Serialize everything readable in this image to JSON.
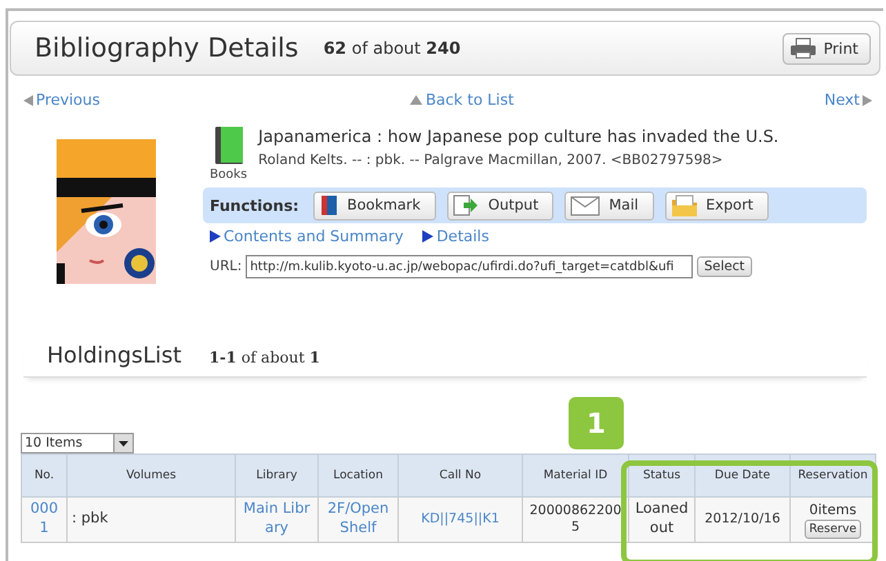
{
  "header": {
    "title": "Bibliography Details",
    "count": "**62** of about **240**",
    "print_button": "Print"
  },
  "nav": {
    "previous": "Previous",
    "back": "Back to List",
    "next": "Next"
  },
  "record": {
    "material_type": "Books",
    "title": "Japanamerica : how Japanese pop culture has invaded the U.S.",
    "details": "Roland Kelts. -- : pbk. -- Palgrave Macmillan, 2007. <BB02797598>",
    "functions_label": "Functions:",
    "functions": [
      {
        "kind": "bookmark",
        "label": "Bookmark"
      },
      {
        "kind": "output",
        "label": "Output"
      },
      {
        "kind": "mail",
        "label": "Mail"
      },
      {
        "kind": "export",
        "label": "Export"
      }
    ],
    "links": [
      "Contents and Summary",
      "Details"
    ],
    "url_label": "URL:",
    "url": "http://m.kulib.kyoto-u.ac.jp/webopac/ufirdi.do?ufi_target=catdbl&ufi",
    "select_button": "Select"
  },
  "holdings": {
    "title": "HoldingsList",
    "count": "**1-1** of about **1**",
    "page_size": "10 Items",
    "callout": "1",
    "columns": [
      "No.",
      "Volumes",
      "Library",
      "Location",
      "Call No",
      "Material ID",
      "Status",
      "Due Date",
      "Reservation"
    ],
    "rows": [
      {
        "no": "0001",
        "volumes": ": pbk",
        "library": "Main Library",
        "location": "2F/Open Shelf",
        "call_no": "KD||745||K1",
        "material_id": "200008622005",
        "status": "Loaned out",
        "due_date": "2012/10/16",
        "reservation": "0items",
        "reserve_button": "Reserve"
      }
    ]
  }
}
